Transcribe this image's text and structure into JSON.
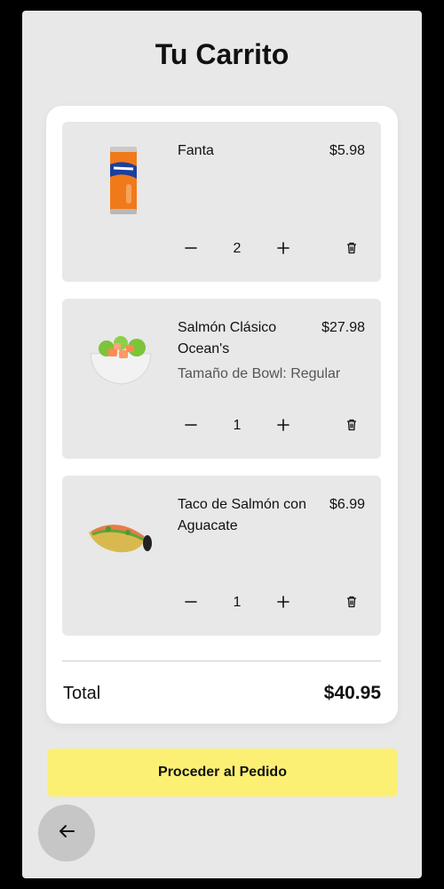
{
  "page": {
    "title": "Tu Carrito"
  },
  "cart": {
    "items": [
      {
        "name": "Fanta",
        "price": "$5.98",
        "option_label": "",
        "option_value": "",
        "quantity": "2",
        "thumb": "fanta-can-image"
      },
      {
        "name": "Salmón Clásico Ocean's",
        "price": "$27.98",
        "option_label": "Tamaño de Bowl:",
        "option_value": "Regular",
        "quantity": "1",
        "thumb": "salmon-bowl-image"
      },
      {
        "name": "Taco de Salmón con Aguacate",
        "price": "$6.99",
        "option_label": "",
        "option_value": "",
        "quantity": "1",
        "thumb": "salmon-taco-image"
      }
    ],
    "total_label": "Total",
    "total_value": "$40.95"
  },
  "actions": {
    "proceed_label": "Proceder al Pedido"
  },
  "icons": {
    "minus": "minus-icon",
    "plus": "plus-icon",
    "trash": "trash-icon",
    "back": "arrow-left-icon"
  },
  "colors": {
    "accent": "#fbf074",
    "background": "#e8e8e8",
    "card": "#ffffff",
    "back_button": "#c6c6c6"
  }
}
